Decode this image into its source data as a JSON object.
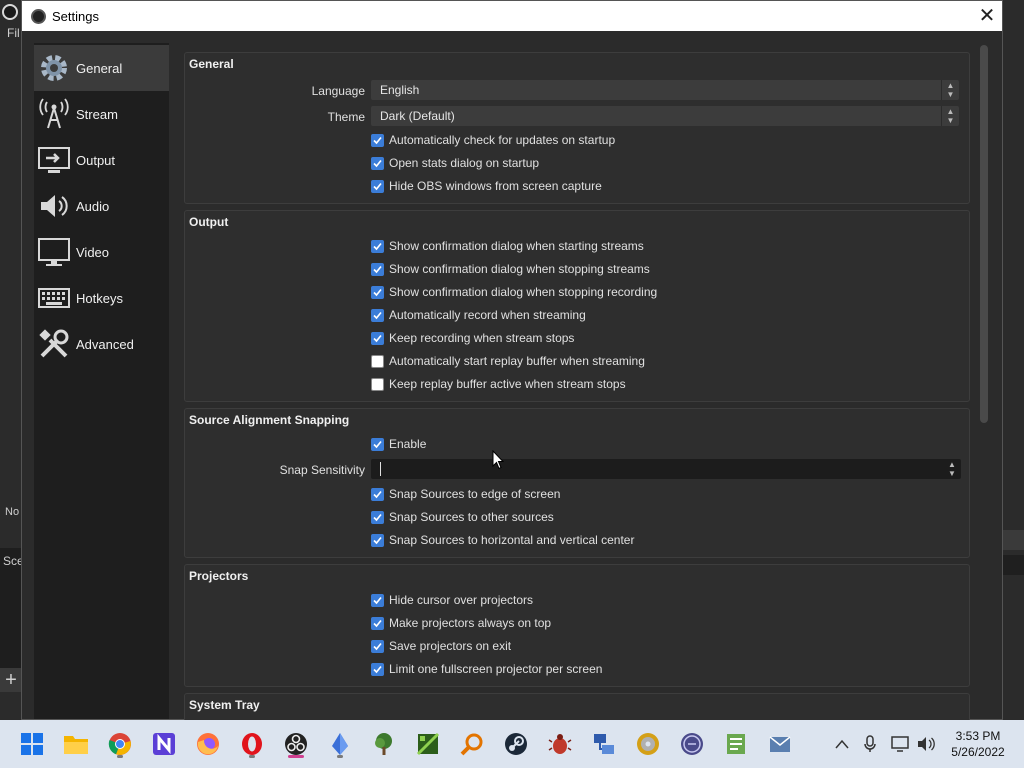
{
  "background_window": {
    "menu_partial": "Fil",
    "label_no": "No",
    "label_sce": "Sce",
    "add_symbol": "+"
  },
  "dialog": {
    "title": "Settings",
    "close_symbol": "✕"
  },
  "sidebar": {
    "items": [
      {
        "label": "General",
        "icon": "gear-icon",
        "active": true
      },
      {
        "label": "Stream",
        "icon": "antenna-icon"
      },
      {
        "label": "Output",
        "icon": "output-monitor-icon"
      },
      {
        "label": "Audio",
        "icon": "speaker-icon"
      },
      {
        "label": "Video",
        "icon": "monitor-icon"
      },
      {
        "label": "Hotkeys",
        "icon": "keyboard-icon"
      },
      {
        "label": "Advanced",
        "icon": "tools-icon"
      }
    ]
  },
  "general": {
    "title": "General",
    "language_label": "Language",
    "language_value": "English",
    "theme_label": "Theme",
    "theme_value": "Dark (Default)",
    "checks": [
      {
        "label": "Automatically check for updates on startup",
        "checked": true
      },
      {
        "label": "Open stats dialog on startup",
        "checked": true
      },
      {
        "label": "Hide OBS windows from screen capture",
        "checked": true
      }
    ]
  },
  "output": {
    "title": "Output",
    "checks": [
      {
        "label": "Show confirmation dialog when starting streams",
        "checked": true
      },
      {
        "label": "Show confirmation dialog when stopping streams",
        "checked": true
      },
      {
        "label": "Show confirmation dialog when stopping recording",
        "checked": true
      },
      {
        "label": "Automatically record when streaming",
        "checked": true
      },
      {
        "label": "Keep recording when stream stops",
        "checked": true
      },
      {
        "label": "Automatically start replay buffer when streaming",
        "checked": false
      },
      {
        "label": "Keep replay buffer active when stream stops",
        "checked": false
      }
    ]
  },
  "snapping": {
    "title": "Source Alignment Snapping",
    "enable_label": "Enable",
    "enable_checked": true,
    "sensitivity_label": "Snap Sensitivity",
    "sensitivity_value": "",
    "checks": [
      {
        "label": "Snap Sources to edge of screen",
        "checked": true
      },
      {
        "label": "Snap Sources to other sources",
        "checked": true
      },
      {
        "label": "Snap Sources to horizontal and vertical center",
        "checked": true
      }
    ]
  },
  "projectors": {
    "title": "Projectors",
    "checks": [
      {
        "label": "Hide cursor over projectors",
        "checked": true
      },
      {
        "label": "Make projectors always on top",
        "checked": true
      },
      {
        "label": "Save projectors on exit",
        "checked": true
      },
      {
        "label": "Limit one fullscreen projector per screen",
        "checked": true
      }
    ]
  },
  "system_tray": {
    "title": "System Tray"
  },
  "taskbar": {
    "apps": [
      {
        "name": "start-menu-icon",
        "color": "#1a73e8"
      },
      {
        "name": "file-explorer-icon",
        "color": "#f4b400"
      },
      {
        "name": "chrome-icon",
        "color": "#db4437",
        "running": true
      },
      {
        "name": "notion-n-icon",
        "color": "#5b3fd6"
      },
      {
        "name": "firefox-icon",
        "color": "#ff7139"
      },
      {
        "name": "opera-icon",
        "color": "#e1141c",
        "running": true
      },
      {
        "name": "obs-icon",
        "color": "#222222",
        "active": true
      },
      {
        "name": "crystal-app-icon",
        "color": "#3a6fd8",
        "running": true
      },
      {
        "name": "tree-app-icon",
        "color": "#3d7a2e"
      },
      {
        "name": "minecraft-app-icon",
        "color": "#4aa02c"
      },
      {
        "name": "search-magnifier-icon",
        "color": "#e37400"
      },
      {
        "name": "steam-icon",
        "color": "#1b2838"
      },
      {
        "name": "beetle-app-icon",
        "color": "#c0392b"
      },
      {
        "name": "network-app-icon",
        "color": "#2e5aac"
      },
      {
        "name": "disc-app-icon",
        "color": "#d4a017"
      },
      {
        "name": "moon-app-icon",
        "color": "#4a4a8a"
      },
      {
        "name": "notepad-app-icon",
        "color": "#6aa84f"
      },
      {
        "name": "mail-app-icon",
        "color": "#5a7fb0"
      }
    ],
    "clock_time": "3:53 PM",
    "clock_date": "5/26/2022"
  },
  "colors": {
    "accent": "#3b7dd8",
    "dialog_bg": "#2b2b2b",
    "sidebar_bg": "#1e1e1e",
    "taskbar_bg": "#dce4ef"
  }
}
